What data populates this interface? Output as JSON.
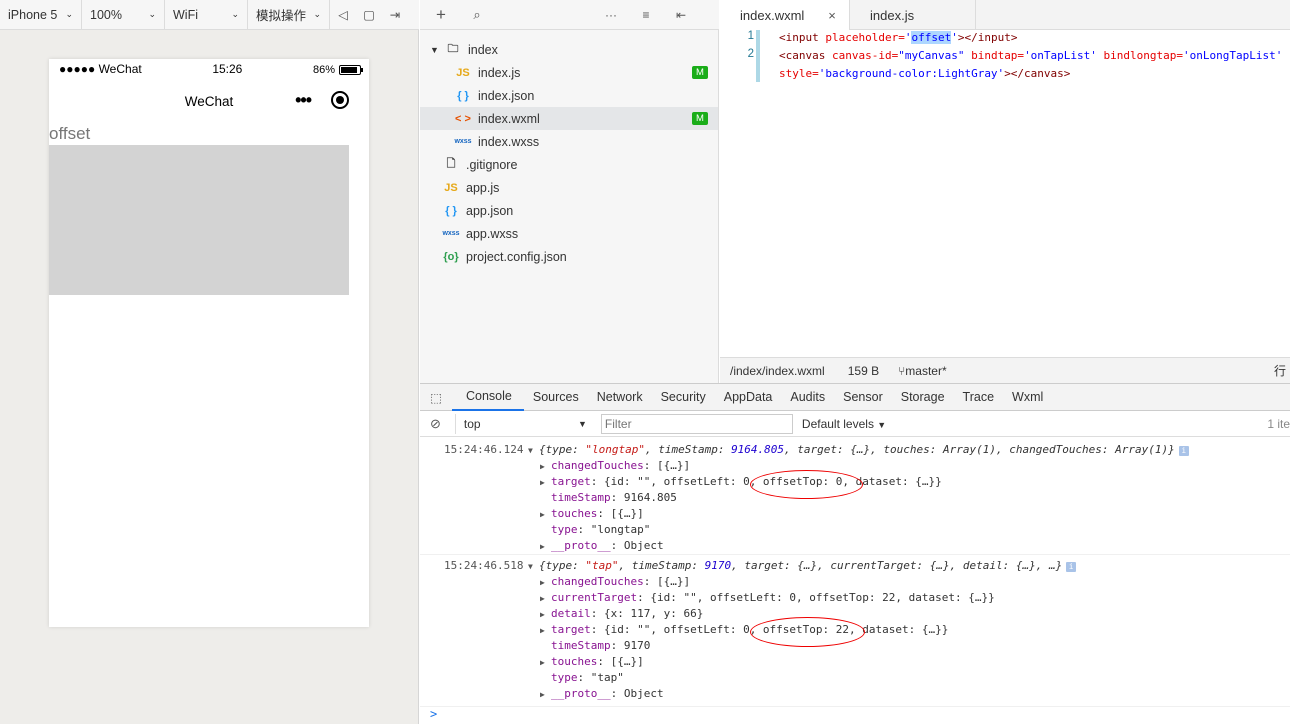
{
  "simulator": {
    "device": "iPhone 5",
    "zoom": "100%",
    "network": "WiFi",
    "operation": "模拟操作",
    "status": {
      "signal": "●●●●● WeChat",
      "time": "15:26",
      "battery": "86%"
    },
    "nav_title": "WeChat",
    "input_placeholder": "offset"
  },
  "file_tree": {
    "root": "index",
    "items": [
      {
        "icon": "JS",
        "name": "index.js",
        "badge": "M",
        "indent": 2
      },
      {
        "icon": "{ }",
        "name": "index.json",
        "badge": "",
        "indent": 2
      },
      {
        "icon": "< >",
        "name": "index.wxml",
        "badge": "M",
        "indent": 2
      },
      {
        "icon": "wxss",
        "name": "index.wxss",
        "badge": "",
        "indent": 2
      },
      {
        "icon": "file",
        "name": ".gitignore",
        "badge": "",
        "indent": 1
      },
      {
        "icon": "JS",
        "name": "app.js",
        "badge": "",
        "indent": 1
      },
      {
        "icon": "{ }",
        "name": "app.json",
        "badge": "",
        "indent": 1
      },
      {
        "icon": "wxss",
        "name": "app.wxss",
        "badge": "",
        "indent": 1
      },
      {
        "icon": "{o}",
        "name": "project.config.json",
        "badge": "",
        "indent": 1
      }
    ]
  },
  "editor": {
    "tabs": [
      "index.wxml",
      "index.js"
    ],
    "close_icon": "×",
    "line_numbers": [
      "1",
      "2"
    ],
    "lines": {
      "l1_open": "<input ",
      "l1_attr": "placeholder=",
      "l1_q1": "'",
      "l1_val": "offset",
      "l1_q2": "'",
      "l1_close": "></input>",
      "l2_open": "<canvas ",
      "l2_attr1": "canvas-id=",
      "l2_val1": "\"myCanvas\"",
      "l2_attr2": " bindtap=",
      "l2_val2": "'onTapList'",
      "l2_attr3": " bindlongtap=",
      "l2_val3": "'onLongTapList'",
      "l3_attr": "style=",
      "l3_val": "'background-color:LightGray'",
      "l3_close": "></canvas>"
    },
    "status": {
      "path": "/index/index.wxml",
      "size": "159 B",
      "branch": "master*",
      "right": "行"
    }
  },
  "devtools": {
    "tabs": [
      "Console",
      "Sources",
      "Network",
      "Security",
      "AppData",
      "Audits",
      "Sensor",
      "Storage",
      "Trace",
      "Wxml"
    ],
    "context": "top",
    "filter_placeholder": "Filter",
    "levels": "Default levels",
    "count": "1 ite"
  },
  "console": {
    "log1": {
      "time": "15:24:46.124",
      "head_a": "{type: ",
      "head_type": "\"longtap\"",
      "head_b": ", timeStamp: ",
      "head_ts": "9164.805",
      "head_c": ", target: {…}, touches: Array(1), changedTouches: Array(1)}",
      "rows": [
        {
          "arrow": "▶",
          "key": "changedTouches",
          "rest": ": [{…}]"
        },
        {
          "arrow": "▶",
          "key": "target",
          "rest": ": {id: \"\", offsetLeft: 0, offsetTop: 0, dataset: {…}}"
        },
        {
          "arrow": "",
          "key": "timeStamp",
          "rest": ": 9164.805"
        },
        {
          "arrow": "▶",
          "key": "touches",
          "rest": ": [{…}]"
        },
        {
          "arrow": "",
          "key": "type",
          "rest": ": \"longtap\""
        },
        {
          "arrow": "▶",
          "key": "__proto__",
          "rest": ": Object"
        }
      ]
    },
    "log2": {
      "time": "15:24:46.518",
      "head_a": "{type: ",
      "head_type": "\"tap\"",
      "head_b": ", timeStamp: ",
      "head_ts": "9170",
      "head_c": ", target: {…}, currentTarget: {…}, detail: {…}, …}",
      "rows": [
        {
          "arrow": "▶",
          "key": "changedTouches",
          "rest": ": [{…}]"
        },
        {
          "arrow": "▶",
          "key": "currentTarget",
          "rest": ": {id: \"\", offsetLeft: 0, offsetTop: 22, dataset: {…}}"
        },
        {
          "arrow": "▶",
          "key": "detail",
          "rest": ": {x: 117, y: 66}"
        },
        {
          "arrow": "▶",
          "key": "target",
          "rest": ": {id: \"\", offsetLeft: 0, offsetTop: 22, dataset: {…}}"
        },
        {
          "arrow": "",
          "key": "timeStamp",
          "rest": ": 9170"
        },
        {
          "arrow": "▶",
          "key": "touches",
          "rest": ": [{…}]"
        },
        {
          "arrow": "",
          "key": "type",
          "rest": ": \"tap\""
        },
        {
          "arrow": "▶",
          "key": "__proto__",
          "rest": ": Object"
        }
      ]
    },
    "prompt": ">"
  },
  "colors": {
    "accent": "#1a73e8",
    "badge": "#1aad19",
    "highlight": "#e00000"
  }
}
